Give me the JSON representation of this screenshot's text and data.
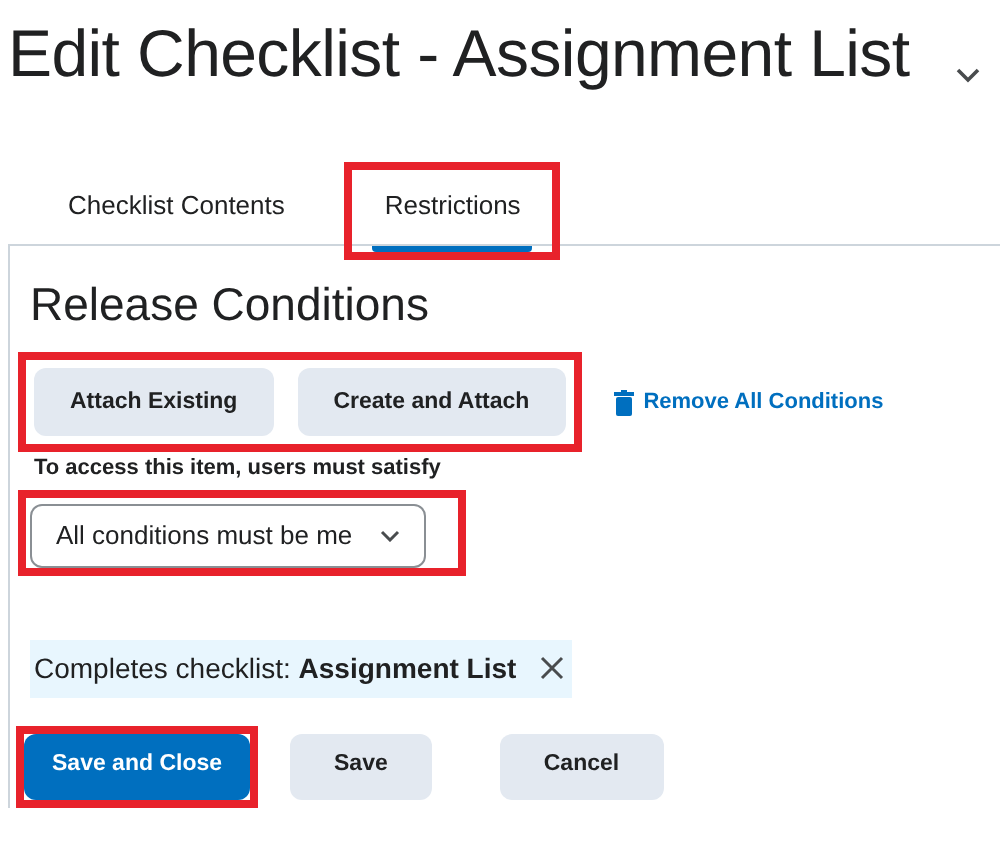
{
  "title": "Edit Checklist - Assignment List",
  "tabs": [
    {
      "label": "Checklist Contents",
      "selected": false,
      "highlighted": false
    },
    {
      "label": "Restrictions",
      "selected": true,
      "highlighted": true
    }
  ],
  "heading": "Release Conditions",
  "condition_buttons": {
    "highlighted": true,
    "items": [
      "Attach Existing",
      "Create and Attach"
    ]
  },
  "remove_all": "Remove All Conditions",
  "select_label": "To access this item, users must satisfy",
  "select": {
    "value": "All conditions must be me",
    "highlighted": true
  },
  "conditions": [
    {
      "text": "Completes checklist: **Assignment List**"
    }
  ],
  "footer_buttons": [
    {
      "label": "Save and Close",
      "kind": "primary",
      "highlighted": true
    },
    {
      "label": "Save",
      "kind": "secondary",
      "highlighted": false
    },
    {
      "label": "Cancel",
      "kind": "secondary",
      "highlighted": false
    }
  ]
}
